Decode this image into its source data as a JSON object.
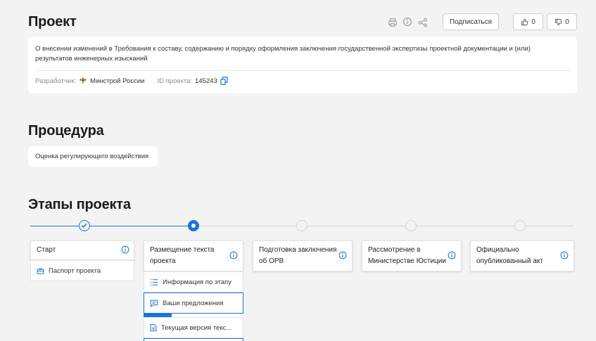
{
  "project": {
    "title": "Проект",
    "subscribe_label": "Подписаться",
    "like_count": "0",
    "dislike_count": "0",
    "description": "О внесении изменений в Требования к составу, содержанию и порядку оформления заключения государственной экспертизы проектной документации и (или) результатов инженерных изысканий",
    "developer_label": "Разработчик:",
    "developer": "Минстрой России",
    "id_label": "ID проекта:",
    "id_value": "145243"
  },
  "procedure": {
    "title": "Процедура",
    "value": "Оценка регулирующего воздействия"
  },
  "stages": {
    "title": "Этапы проекта",
    "items": [
      {
        "label": "Старт",
        "status": "done"
      },
      {
        "label": "Размещение текста проекта",
        "status": "current"
      },
      {
        "label": "Подготовка заключения об ОРВ",
        "status": "pending"
      },
      {
        "label": "Рассмотрение в Министерстве Юстиции",
        "status": "pending"
      },
      {
        "label": "Официально опубликованный акт",
        "status": "pending"
      }
    ],
    "start_sub": "Паспорт проекта",
    "current_subs": {
      "info": "Информация по этапу",
      "proposals": "Ваши предложения",
      "proposals_progress": 0.28,
      "text_version": "Текущая версия текс..."
    }
  },
  "colors": {
    "accent": "#1a73d9",
    "inactive": "#d4d4d4",
    "background": "#f3f3f3"
  },
  "icons": [
    "print-icon",
    "info-icon",
    "share-icon",
    "thumb-up-icon",
    "thumb-down-icon",
    "copy-icon",
    "check-icon",
    "briefcase-icon",
    "list-icon",
    "comment-icon",
    "document-icon"
  ]
}
